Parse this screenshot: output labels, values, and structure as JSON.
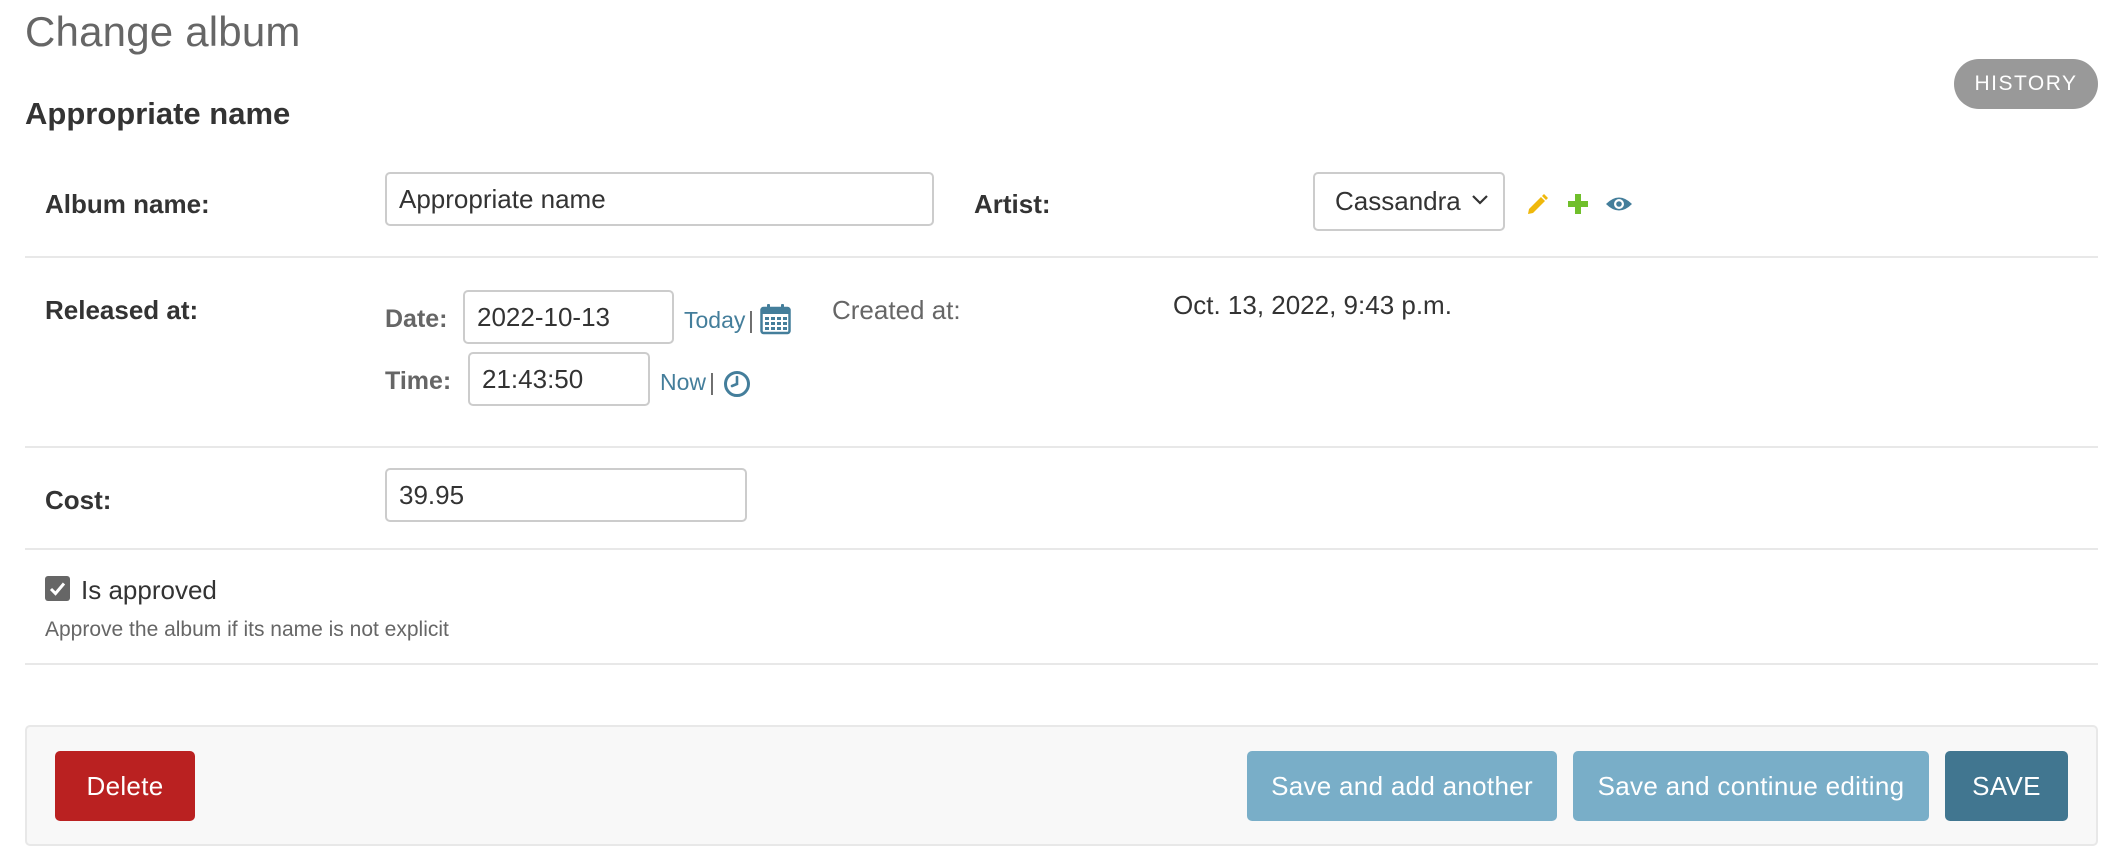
{
  "page": {
    "title": "Change album",
    "history_label": "HISTORY",
    "fieldset_title": "Appropriate name"
  },
  "form": {
    "album_name": {
      "label": "Album name:",
      "value": "Appropriate name"
    },
    "artist": {
      "label": "Artist:",
      "selected": "Cassandra",
      "icons": [
        "pencil-icon",
        "plus-icon",
        "eye-icon"
      ],
      "icon_colors": {
        "edit": "#efb80b",
        "add": "#70bf2b",
        "view": "#447e9b"
      }
    },
    "released_at": {
      "label": "Released at:",
      "date_label": "Date:",
      "date_value": "2022-10-13",
      "today_link": "Today",
      "time_label": "Time:",
      "time_value": "21:43:50",
      "now_link": "Now",
      "separator": "|"
    },
    "created_at": {
      "label": "Created at:",
      "value": "Oct. 13, 2022, 9:43 p.m."
    },
    "cost": {
      "label": "Cost:",
      "value": "39.95"
    },
    "is_approved": {
      "label": "Is approved",
      "checked": true,
      "help_text": "Approve the album if its name is not explicit"
    }
  },
  "actions": {
    "delete": "Delete",
    "save_add_another": "Save and add another",
    "save_continue": "Save and continue editing",
    "save": "SAVE"
  },
  "colors": {
    "delete_bg": "#ba2121",
    "secondary_bg": "#79aec8",
    "primary_bg": "#417690",
    "link": "#447e9b"
  }
}
